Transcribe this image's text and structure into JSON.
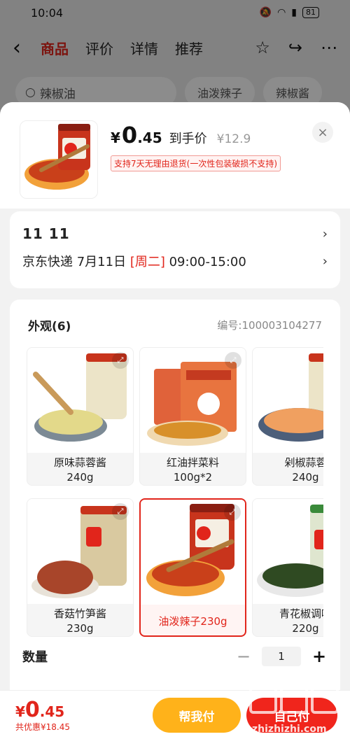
{
  "status": {
    "time": "10:04",
    "battery": "81"
  },
  "nav": {
    "tabs": [
      "商品",
      "评价",
      "详情",
      "推荐"
    ],
    "active": 0
  },
  "search": {
    "query": "辣椒油",
    "chips": [
      "油泼辣子",
      "辣椒酱"
    ]
  },
  "sheet": {
    "price_yen": "¥",
    "price_int": "0",
    "price_dec": ".45",
    "price_tag": "到手价",
    "orig_price": "¥12.9",
    "return_policy": "支持7天无理由退货(一次性包装破损不支持)",
    "close": "×"
  },
  "delivery": {
    "title": "11  11",
    "carrier_date": "京东快递 7月11日",
    "weekday": "[周二]",
    "time_window": "09:00-15:00"
  },
  "variants": {
    "title": "外观(6)",
    "code": "编号:100003104277",
    "items": [
      {
        "name": "原味蒜蓉酱",
        "spec": "240g"
      },
      {
        "name": "红油拌菜料",
        "spec": "100g*2"
      },
      {
        "name": "剁椒蒜蓉",
        "spec": "240g"
      },
      {
        "name": "香菇竹笋酱",
        "spec": "230g"
      },
      {
        "name": "油泼辣子230g",
        "spec": ""
      },
      {
        "name": "青花椒调味",
        "spec": "220g"
      }
    ],
    "selected": 4
  },
  "quantity": {
    "label": "数量",
    "value": "1",
    "minus": "−",
    "plus": "+"
  },
  "bottom": {
    "yen": "¥",
    "int": "0",
    "dec": ".45",
    "saved": "共优惠¥18.45",
    "help_pay": "帮我付",
    "self_pay": "自己付"
  },
  "colors": {
    "brand_red": "#e1251b",
    "help_yellow": "#ffb21a"
  }
}
